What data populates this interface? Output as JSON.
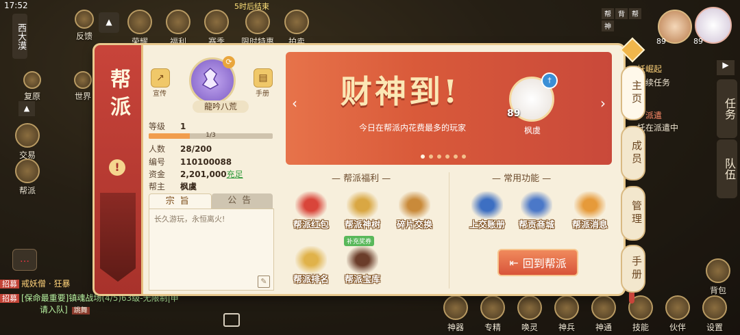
{
  "status": {
    "time": "17:52",
    "event_timer": "5时后结束"
  },
  "top_hud": [
    {
      "label": "反馈"
    },
    {
      "label": "荣耀"
    },
    {
      "label": "福利"
    },
    {
      "label": "赛季"
    },
    {
      "label": "限时特惠"
    },
    {
      "label": "拍卖"
    }
  ],
  "left_hud": {
    "map_name": "西大漠",
    "restore": "复原",
    "world": "世界",
    "trade": "交易",
    "guild": "帮派"
  },
  "top_right": {
    "player_level_1": "89",
    "player_level_2": "89",
    "mini_labels": [
      "帮",
      "背",
      "帮",
      "神"
    ]
  },
  "quest": {
    "title": "妖崛起",
    "line1": "继续任务",
    "line2": "：派遣",
    "line3": "托在派遣中",
    "tab_task": "任务",
    "tab_team": "队伍"
  },
  "panel": {
    "banner_title": "帮派",
    "warning": "!",
    "guild": {
      "name": "龍吟八荒",
      "share_label": "宣传",
      "manual_label": "手册",
      "level_key": "等级",
      "level_val": "1",
      "xp_text": "1/3",
      "xp_fraction": 0.333,
      "members_key": "人数",
      "members_val": "28/200",
      "id_key": "编号",
      "id_val": "110100088",
      "funds_key": "资金",
      "funds_val": "2,201,000",
      "recharge": "充足",
      "leader_key": "帮主",
      "leader_val": "枫虞"
    },
    "tabs": {
      "motto": "宗旨",
      "notice": "公告"
    },
    "motto_text": "长久游玩，永恒离火!",
    "carousel": {
      "title": "财神到!",
      "subtitle": "今日在帮派内花费最多的玩家",
      "winner_level": "89",
      "winner_name": "枫虞",
      "slides": 6,
      "active_slide": 0
    },
    "welfare": {
      "title": "帮派福利",
      "items": [
        {
          "label": "帮派红包",
          "color": "#d9453a"
        },
        {
          "label": "帮派神树",
          "color": "#d9a743"
        },
        {
          "label": "碎片交换",
          "color": "#c98a3a"
        },
        {
          "label": "帮派排名",
          "color": "#e0b24a"
        },
        {
          "label": "帮派宝库",
          "color": "#6b3d2a"
        }
      ],
      "badge": "补充奖券"
    },
    "common": {
      "title": "常用功能",
      "items": [
        {
          "label": "上交账册",
          "color": "#3d6fc2"
        },
        {
          "label": "帮贡商城",
          "color": "#4b78c8"
        },
        {
          "label": "帮派消息",
          "color": "#e69a3a"
        }
      ],
      "return_button": "回到帮派"
    },
    "right_nav": [
      {
        "label": "主页",
        "active": true
      },
      {
        "label": "成员",
        "active": false
      },
      {
        "label": "管理",
        "active": false
      },
      {
        "label": "手册",
        "active": false
      }
    ]
  },
  "chat": [
    {
      "tag": "招募",
      "text": "戒妖僧 · 狂暴"
    },
    {
      "tag": "招募",
      "text": "[保命最重要]镇魂战场(4/5)63级-无限制|申"
    },
    {
      "tag": "",
      "text": "请入队]",
      "extra": "跳舞"
    }
  ],
  "bottom_bar": [
    "神器",
    "专精",
    "唤灵",
    "神兵",
    "神通",
    "技能",
    "伙伴",
    "设置"
  ],
  "right_side": {
    "backpack": "背包"
  }
}
